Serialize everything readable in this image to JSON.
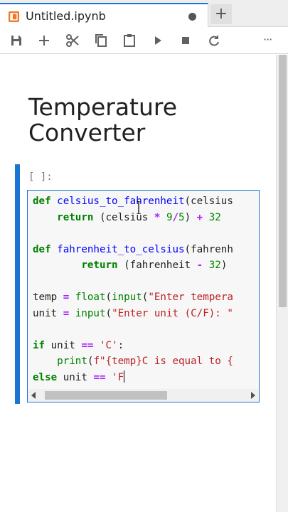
{
  "tab": {
    "title": "Untitled.ipynb",
    "icon": "notebook-icon",
    "unsaved_indicator": "dirty-dot-icon",
    "add_label": "+"
  },
  "toolbar": {
    "buttons": [
      "save-icon",
      "add-cell-icon",
      "cut-icon",
      "copy-icon",
      "paste-icon",
      "run-icon",
      "stop-icon",
      "restart-icon",
      "more-icon"
    ],
    "more_label": "···"
  },
  "notebook": {
    "markdown_title_line1": "Temperature",
    "markdown_title_line2": "Converter",
    "code_cell": {
      "prompt": "[ ]:",
      "lines": [
        "def celsius_to_fahrenheit(celsius",
        "    return (celsius * 9/5) + 32",
        "",
        "def fahrenheit_to_celsius(fahrenh",
        "        return (fahrenheit - 32)",
        "",
        "temp = float(input(\"Enter tempera",
        "unit = input(\"Enter unit (C/F): \"",
        "",
        "if unit == 'C':",
        "    print(f\"{temp}C is equal to {",
        "else unit == 'F"
      ]
    }
  },
  "colors": {
    "accent": "#1976d2",
    "keyword": "#008000",
    "function": "#0000ff",
    "string": "#ba2121",
    "operator": "#aa22ff",
    "jupyter_orange": "#f37726"
  }
}
